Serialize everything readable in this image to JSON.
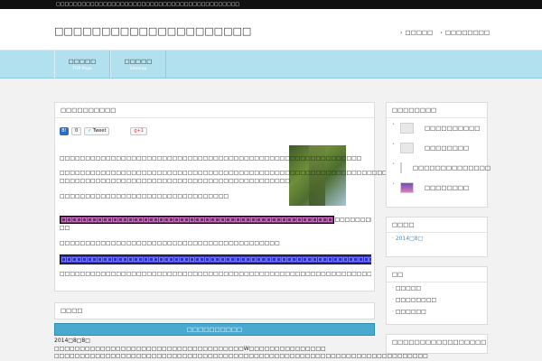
{
  "topbar": {
    "text": "□□□□□□□□□□□□□□□□□□□□□□□□□□□□□□□□□□□□□□□□□□□"
  },
  "header": {
    "site_title": "□□□□□□□□□□□□□□□□□□□□□",
    "links": [
      "□□□□□",
      "□□□□□□□□"
    ]
  },
  "nav": {
    "items": [
      {
        "label": "□□□□□",
        "sub": "TOP Page"
      },
      {
        "label": "□□□□□",
        "sub": "Sitemap"
      }
    ]
  },
  "post": {
    "title": "□□□□□□□□□□",
    "hatena_count": "0",
    "tweet_label": "Tweet",
    "gplus_label": "g+1",
    "p1": "□□□□□□□□□□□□□□□□□□□□□□□□□□□□□□□□□□□□□□□□□□□□□□□□□□□□□□□□□□□",
    "p2a": "□□□□□□□□□□□□□□□□□□□□□□□□□□□□□□□□□□□□□□□□□□□□□□□□□□□□□□□□□□□□□□□□□□□□□□□□□",
    "p2b": "□□□□□□□□□□□□□□□□□□□□□□□□□□□□□□□□□□□□□□□□□□□□□",
    "p3": "□□□□□□□□□□□□□□□□□□□□□□□□□□□□□□□□□",
    "hl1": "□□□□□□□□□□□□□□□□□□□□□□□□□□□□□□□□□□□□□□□□□□□□□□□□□□□□□",
    "hl1_rest": "□□□□□□□□□□□□□□□□□□□□□□□□□□□□",
    "hl1_wrap": "□□",
    "p5": "□□□□□□□□□□□□□□□□□□□□□□□□□□□□□□□□□□□□□□□□□□□",
    "hl2": "□□□□□□□□□□□□□□□□□□□□□□□□□□□□□□□□□□□□□□□□□□□□□□□□□□□□□□□□□□□□□□□□□□□□□",
    "p7": "□□□□□□□□□□□□□□□□□□□□□□□□□□□□□□□□□□□□□□□□□□□□□□□□□□□□□□□□□□□□□□□□□□□□□□□□□□□□□□□"
  },
  "calendar": {
    "box_title": "□□□□",
    "bar_label": "□□□□□□□□□□",
    "date": "2014□8□8□",
    "line1": "□□□□□□□□□□□□□□□□□□□□□□□□□□□□□□□□□□□□□W□□□□□□□□□□□□□□□",
    "line2": "□□□□□□□□□□□□□□□□□□□□□□□□□□□□□□□□□□□□□□□□□□□□□□□□□□□□□□□□□□□□□□□□□□□□□□□□□"
  },
  "sidebar": {
    "recent": {
      "title": "□□□□□□□□",
      "items": [
        "□□□□□□□□□□",
        "□□□□□□□□",
        "□□□□□□□□□□□□□□",
        "□□□□□□□□"
      ]
    },
    "archive": {
      "title": "□□□□",
      "items": [
        "2014□8□"
      ]
    },
    "category": {
      "title": "□□",
      "items": [
        "□□□□□",
        "□□□□□□□□",
        "□□□□□□"
      ]
    },
    "last": {
      "title": "□□□□□□□□□□□□□□□□□"
    }
  }
}
